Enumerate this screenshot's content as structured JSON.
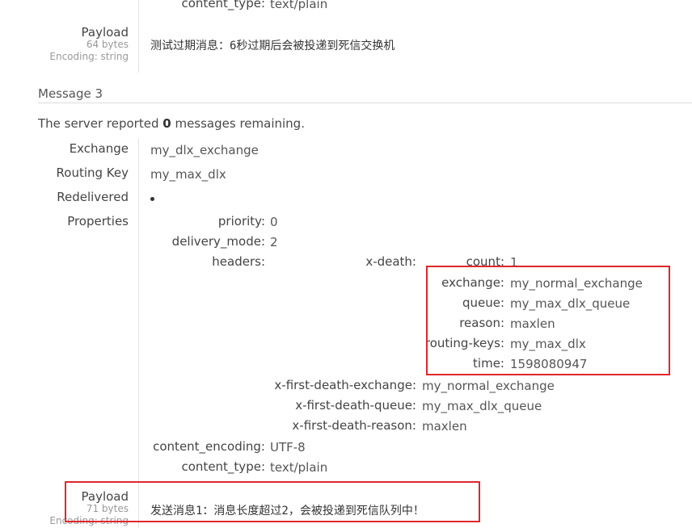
{
  "prev": {
    "content_type_label": "content_type:",
    "content_type_value": "text/plain",
    "payload_label": "Payload",
    "payload_size": "64 bytes",
    "payload_encoding": "Encoding: string",
    "payload_text": "测试过期消息：6秒过期后会被投递到死信交换机"
  },
  "message3": {
    "heading": "Message 3",
    "remaining_prefix": "The server reported ",
    "remaining_count": "0",
    "remaining_suffix": " messages remaining.",
    "exchange_label": "Exchange",
    "exchange_value": "my_dlx_exchange",
    "routing_key_label": "Routing Key",
    "routing_key_value": "my_max_dlx",
    "redelivered_label": "Redelivered",
    "properties_label": "Properties",
    "properties": {
      "priority_label": "priority:",
      "priority_value": "0",
      "delivery_mode_label": "delivery_mode:",
      "delivery_mode_value": "2",
      "headers_label": "headers:",
      "x_death_label": "x-death:",
      "x_death": {
        "count_label": "count:",
        "count_value": "1",
        "exchange_label": "exchange:",
        "exchange_value": "my_normal_exchange",
        "queue_label": "queue:",
        "queue_value": "my_max_dlx_queue",
        "reason_label": "reason:",
        "reason_value": "maxlen",
        "routing_keys_label": "routing-keys:",
        "routing_keys_value": "my_max_dlx",
        "time_label": "time:",
        "time_value": "1598080947"
      },
      "x_first_death_exchange_label": "x-first-death-exchange:",
      "x_first_death_exchange_value": "my_normal_exchange",
      "x_first_death_queue_label": "x-first-death-queue:",
      "x_first_death_queue_value": "my_max_dlx_queue",
      "x_first_death_reason_label": "x-first-death-reason:",
      "x_first_death_reason_value": "maxlen",
      "content_encoding_label": "content_encoding:",
      "content_encoding_value": "UTF-8",
      "content_type_label": "content_type:",
      "content_type_value": "text/plain"
    },
    "payload_label": "Payload",
    "payload_size": "71 bytes",
    "payload_encoding": "Encoding: string",
    "payload_text": "发送消息1：消息长度超过2，会被投递到死信队列中！"
  },
  "colors": {
    "highlight_box": "#e0262e",
    "divider": "#dcdcdc"
  }
}
